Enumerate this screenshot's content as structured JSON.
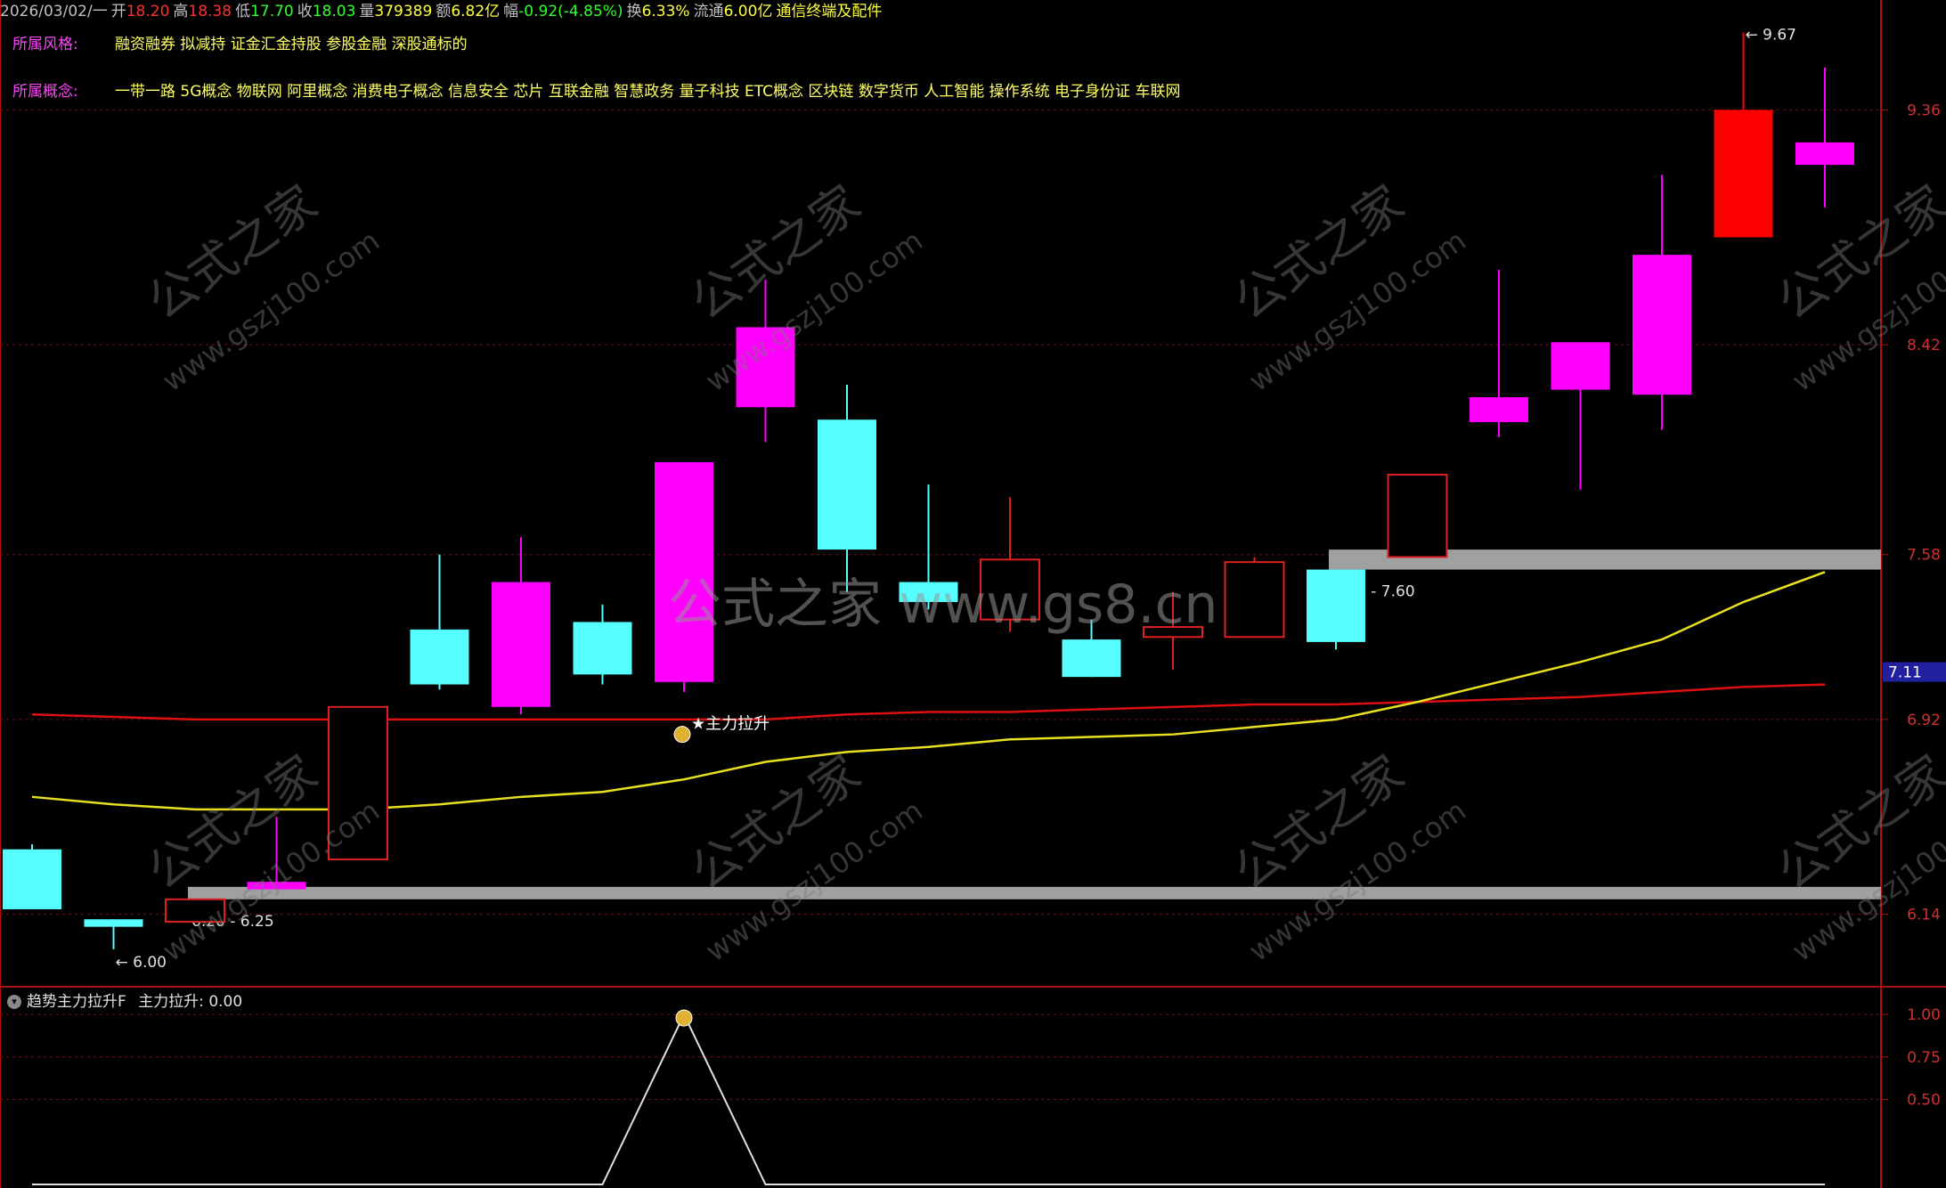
{
  "header": {
    "date": "2026/03/02/一",
    "open_label": "开",
    "open": "18.20",
    "high_label": "高",
    "high": "18.38",
    "low_label": "低",
    "low": "17.70",
    "close_label": "收",
    "close": "18.03",
    "volume_label": "量",
    "volume": "379389",
    "amount_label": "额",
    "amount": "6.82亿",
    "change_label": "幅",
    "change": "-0.92(-4.85%)",
    "turnover_label": "换",
    "turnover": "6.33%",
    "float_label": "流通",
    "float": "6.00亿",
    "industry": "通信终端及配件"
  },
  "info": {
    "style_label": "所属风格:",
    "style_value": "融资融券 拟减持 证金汇金持股 参股金融 深股通标的",
    "concept_label": "所属概念:",
    "concept_value": "一带一路 5G概念 物联网 阿里概念 消费电子概念 信息安全 芯片 互联金融 智慧政务 量子科技 ETC概念 区块链 数字货币 人工智能 操作系统 电子身份证 车联网"
  },
  "watermark": {
    "center_text": "公式之家 www.gs8.cn",
    "tile_text": "公式之家",
    "tile_url": "www.gszj100.com"
  },
  "colors": {
    "up": "#ff00ff",
    "down": "#55ffff",
    "hollow": "#e02020",
    "red_line": "#e01010",
    "yellow_line": "#e8e020",
    "zone": "#a0a0a0",
    "grid": "#7a1010",
    "accent_blue": "#2020a0"
  },
  "chart_data": [
    {
      "type": "candlestick",
      "price_ticks": [
        "9.36",
        "8.42",
        "7.58",
        "6.92",
        "6.14"
      ],
      "current_price_tag": "7.11",
      "ylim": [
        5.85,
        9.8
      ],
      "candles": [
        {
          "o": 6.4,
          "h": 6.42,
          "l": 6.16,
          "c": 6.16
        },
        {
          "o": 6.12,
          "h": 6.12,
          "l": 6.0,
          "c": 6.09
        },
        {
          "o": 6.11,
          "h": 6.2,
          "l": 6.11,
          "c": 6.2,
          "hollow": true
        },
        {
          "o": 6.24,
          "h": 6.53,
          "l": 6.24,
          "c": 6.27
        },
        {
          "o": 6.36,
          "h": 6.97,
          "l": 6.36,
          "c": 6.97,
          "hollow": true
        },
        {
          "o": 7.28,
          "h": 7.58,
          "l": 7.04,
          "c": 7.06
        },
        {
          "o": 6.97,
          "h": 7.65,
          "l": 6.94,
          "c": 7.47
        },
        {
          "o": 7.31,
          "h": 7.38,
          "l": 7.06,
          "c": 7.1
        },
        {
          "o": 7.07,
          "h": 7.95,
          "l": 7.03,
          "c": 7.95
        },
        {
          "o": 8.17,
          "h": 8.68,
          "l": 8.03,
          "c": 8.49
        },
        {
          "o": 8.12,
          "h": 8.26,
          "l": 7.43,
          "c": 7.6
        },
        {
          "o": 7.47,
          "h": 7.86,
          "l": 7.36,
          "c": 7.39
        },
        {
          "o": 7.32,
          "h": 7.81,
          "l": 7.27,
          "c": 7.56,
          "hollow": true
        },
        {
          "o": 7.24,
          "h": 7.32,
          "l": 7.09,
          "c": 7.09
        },
        {
          "o": 7.25,
          "h": 7.43,
          "l": 7.12,
          "c": 7.29,
          "hollow": true
        },
        {
          "o": 7.25,
          "h": 7.57,
          "l": 7.25,
          "c": 7.55,
          "hollow": true
        },
        {
          "o": 7.52,
          "h": 7.52,
          "l": 7.2,
          "c": 7.23
        },
        {
          "o": 7.57,
          "h": 7.9,
          "l": 7.57,
          "c": 7.9,
          "hollow": true
        },
        {
          "o": 8.11,
          "h": 8.72,
          "l": 8.05,
          "c": 8.21
        },
        {
          "o": 8.24,
          "h": 8.28,
          "l": 7.84,
          "c": 8.43
        },
        {
          "o": 8.22,
          "h": 9.1,
          "l": 8.08,
          "c": 8.78
        },
        {
          "o": 8.85,
          "h": 9.67,
          "l": 8.85,
          "c": 9.36,
          "solid_red": true
        },
        {
          "o": 9.14,
          "h": 9.53,
          "l": 8.97,
          "c": 9.23
        }
      ],
      "red_line": [
        6.94,
        6.93,
        6.92,
        6.92,
        6.92,
        6.92,
        6.92,
        6.92,
        6.92,
        6.92,
        6.94,
        6.95,
        6.95,
        6.96,
        6.97,
        6.98,
        6.98,
        6.99,
        7.0,
        7.01,
        7.03,
        7.05,
        7.06
      ],
      "yellow_line": [
        6.61,
        6.58,
        6.56,
        6.56,
        6.56,
        6.58,
        6.61,
        6.63,
        6.68,
        6.75,
        6.79,
        6.81,
        6.84,
        6.85,
        6.86,
        6.89,
        6.92,
        6.99,
        7.07,
        7.15,
        7.24,
        7.39,
        7.51
      ],
      "zones": [
        {
          "label": "6.20 - 6.25",
          "low": 6.2,
          "high": 6.25,
          "start_index": 2
        },
        {
          "label": "7.52 - 7.60",
          "low": 7.52,
          "high": 7.6,
          "start_index": 16
        }
      ],
      "annotations": [
        {
          "text": "9.67",
          "index": 21,
          "price": 9.67
        },
        {
          "text": "6.00",
          "index": 1,
          "price": 6.0
        },
        {
          "text": "★主力拉升",
          "index": 8,
          "price": 6.91
        }
      ]
    },
    {
      "type": "line",
      "title": "趋势主力拉升F",
      "series_label": "主力拉升: 0.00",
      "y_ticks": [
        "1.00",
        "0.75",
        "0.50"
      ],
      "ylim": [
        0,
        1.1
      ],
      "values": [
        0,
        0,
        0,
        0,
        0,
        0,
        0,
        0,
        1,
        0,
        0,
        0,
        0,
        0,
        0,
        0,
        0,
        0,
        0,
        0,
        0,
        0,
        0
      ]
    }
  ]
}
